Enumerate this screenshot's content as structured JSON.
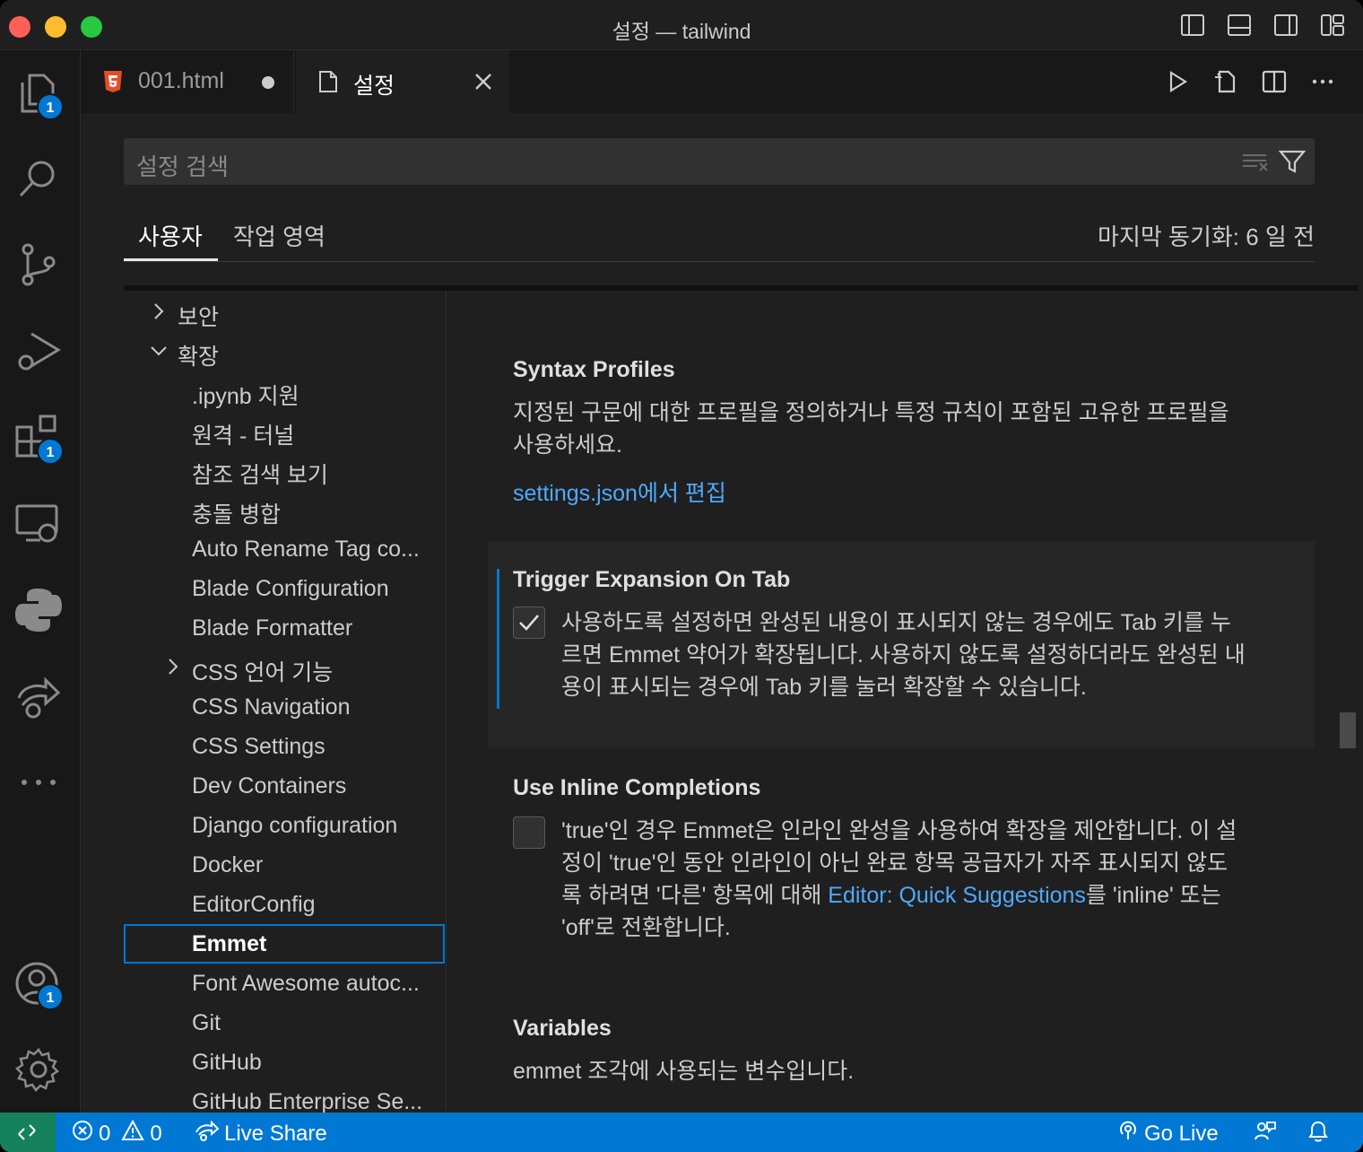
{
  "window": {
    "title": "설정 — tailwind"
  },
  "activity_bar": {
    "explorer_badge": "1",
    "extensions_badge": "1",
    "accounts_badge": "1"
  },
  "tabs": [
    {
      "label": "001.html",
      "modified": true
    },
    {
      "label": "설정",
      "active": true
    }
  ],
  "search": {
    "placeholder": "설정 검색"
  },
  "scope": {
    "user": "사용자",
    "workspace": "작업 영역",
    "sync_status": "마지막 동기화: 6 일 전"
  },
  "toc": [
    {
      "label": "보안",
      "chevron": "right"
    },
    {
      "label": "확장",
      "chevron": "down"
    },
    {
      "label": ".ipynb 지원"
    },
    {
      "label": "원격 - 터널"
    },
    {
      "label": "참조 검색 보기"
    },
    {
      "label": "충돌 병합"
    },
    {
      "label": "Auto Rename Tag co..."
    },
    {
      "label": "Blade Configuration"
    },
    {
      "label": "Blade Formatter"
    },
    {
      "label": "CSS 언어 기능",
      "chevron": "right"
    },
    {
      "label": "CSS Navigation"
    },
    {
      "label": "CSS Settings"
    },
    {
      "label": "Dev Containers"
    },
    {
      "label": "Django configuration"
    },
    {
      "label": "Docker"
    },
    {
      "label": "EditorConfig"
    },
    {
      "label": "Emmet",
      "selected": true
    },
    {
      "label": "Font Awesome autoc..."
    },
    {
      "label": "Git"
    },
    {
      "label": "GitHub"
    },
    {
      "label": "GitHub Enterprise Se..."
    }
  ],
  "settings": {
    "syntax_profiles": {
      "title": "Syntax Profiles",
      "desc_line1": "지정된 구문에 대한 프로필을 정의하거나 특정 규칙이 포함된 고유한 프로필을",
      "desc_line2": "사용하세요.",
      "link": "settings.json에서 편집"
    },
    "trigger_expansion": {
      "title": "Trigger Expansion On Tab",
      "checked": true,
      "desc_line1": "사용하도록 설정하면 완성된 내용이 표시되지 않는 경우에도 Tab 키를 누",
      "desc_line2": "르면 Emmet 약어가 확장됩니다. 사용하지 않도록 설정하더라도 완성된 내",
      "desc_line3": "용이 표시되는 경우에 Tab 키를 눌러 확장할 수 있습니다."
    },
    "inline_completions": {
      "title": "Use Inline Completions",
      "checked": false,
      "desc_line1": "'true'인 경우 Emmet은 인라인 완성을 사용하여 확장을 제안합니다. 이 설",
      "desc_line2": "정이 'true'인 동안 인라인이 아닌 완료 항목 공급자가 자주 표시되지 않도",
      "desc_line3_pre": "록 하려면 '다른' 항목에 대해 ",
      "desc_line3_link": "Editor: Quick Suggestions",
      "desc_line3_post": "를 'inline' 또는",
      "desc_line4": "'off'로 전환합니다."
    },
    "variables": {
      "title": "Variables",
      "desc": "emmet 조각에 사용되는 변수입니다."
    }
  },
  "status_bar": {
    "errors": "0",
    "warnings": "0",
    "live_share": "Live Share",
    "go_live": "Go Live"
  },
  "colors": {
    "accent": "#0078d4",
    "remote": "#16825d",
    "link": "#4daafc"
  }
}
